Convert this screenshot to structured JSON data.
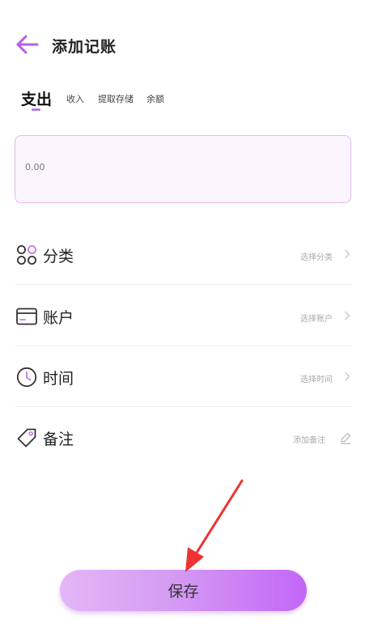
{
  "header": {
    "title": "添加记账",
    "back_icon": "arrow-left-icon"
  },
  "tabs": [
    {
      "label": "支出",
      "active": true
    },
    {
      "label": "收入",
      "active": false
    },
    {
      "label": "提取存储",
      "active": false
    },
    {
      "label": "余额",
      "active": false
    }
  ],
  "amount": {
    "placeholder": "0.00"
  },
  "rows": [
    {
      "label": "分类",
      "hint": "选择分类",
      "icon": "category-icon"
    },
    {
      "label": "账户",
      "hint": "选择账户",
      "icon": "card-icon"
    },
    {
      "label": "时间",
      "hint": "选择时间",
      "icon": "clock-icon"
    },
    {
      "label": "备注",
      "hint": "添加备注",
      "icon": "tag-icon"
    }
  ],
  "save": {
    "label": "保存"
  },
  "colors": {
    "accent": "#b27ce6",
    "save_gradient_start": "#e4b6f6",
    "save_gradient_end": "#c266f7",
    "annotation_arrow": "#ee3333"
  }
}
